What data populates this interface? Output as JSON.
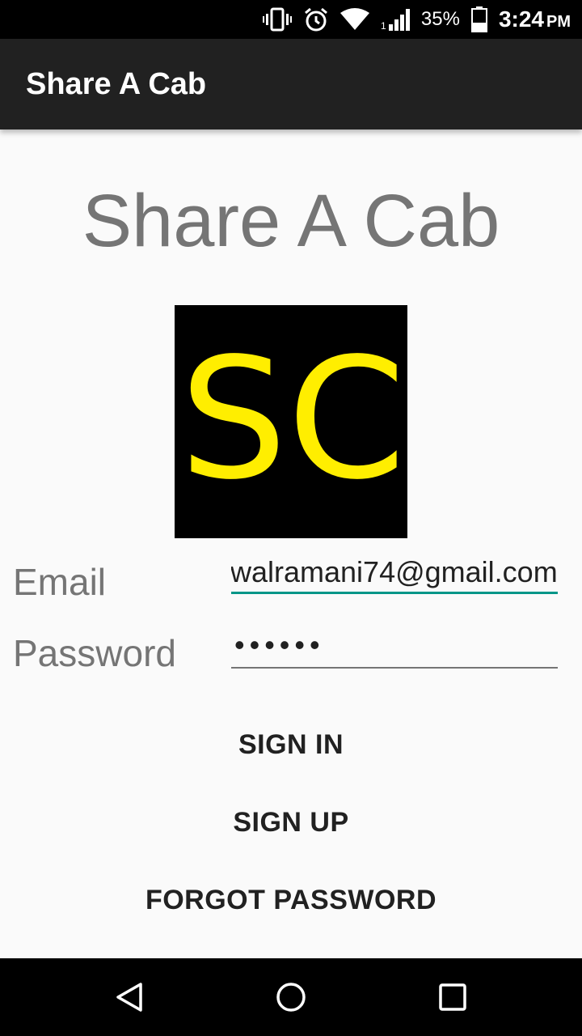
{
  "status_bar": {
    "battery_percent": "35%",
    "time": "3:24",
    "time_suffix": "PM",
    "icons": [
      "vibrate-icon",
      "alarm-icon",
      "wifi-icon",
      "signal-icon",
      "battery-icon"
    ]
  },
  "app_bar": {
    "title": "Share A Cab"
  },
  "hero": {
    "title": "Share A Cab"
  },
  "logo": {
    "text": "SC",
    "background": "#000000",
    "text_color": "#FFEE00"
  },
  "form": {
    "email_label": "Email",
    "email_value": "walramani74@gmail.com",
    "password_label": "Password",
    "password_value": "••••••"
  },
  "buttons": {
    "sign_in": "SIGN IN",
    "sign_up": "SIGN UP",
    "forgot_password": "FORGOT PASSWORD"
  },
  "colors": {
    "accent": "#009688",
    "app_bar": "#212121",
    "hint_text": "#757575"
  },
  "nav_bar": {
    "icons": [
      "back-icon",
      "home-icon",
      "recents-icon"
    ]
  }
}
